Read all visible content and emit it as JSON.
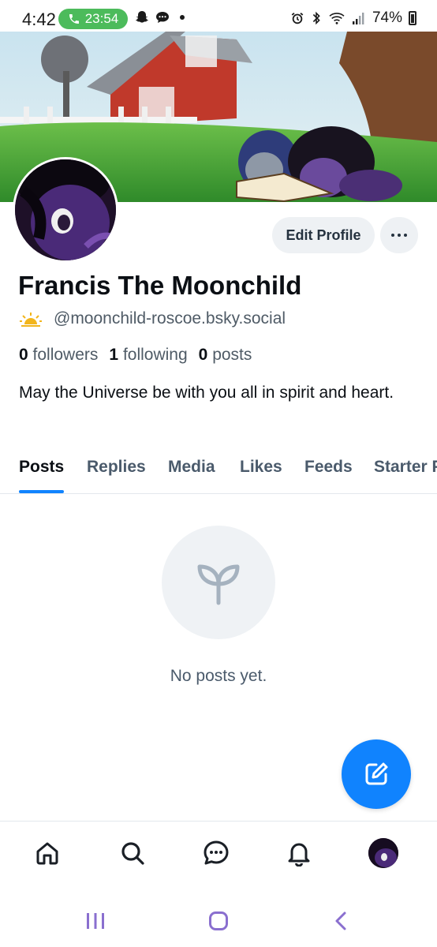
{
  "status_bar": {
    "time": "4:42",
    "call_timer": "23:54",
    "battery": "74%"
  },
  "profile": {
    "display_name": "Francis The Moonchild",
    "handle": "@moonchild-roscoe.bsky.social",
    "followers_count": "0",
    "followers_label": "followers",
    "following_count": "1",
    "following_label": "following",
    "posts_count": "0",
    "posts_label": "posts",
    "bio": "May the Universe be with you all in spirit and heart.",
    "edit_button_label": "Edit Profile"
  },
  "tabs": [
    {
      "label": "Posts",
      "active": true
    },
    {
      "label": "Replies"
    },
    {
      "label": "Media"
    },
    {
      "label": "Likes"
    },
    {
      "label": "Feeds"
    },
    {
      "label": "Starter Packs"
    }
  ],
  "empty_state": {
    "text": "No posts yet.",
    "icon": "sprout-icon"
  },
  "bottom_nav": {
    "items": [
      "home-icon",
      "search-icon",
      "chat-icon",
      "notifications-icon",
      "profile-avatar"
    ]
  },
  "colors": {
    "accent": "#1083fe",
    "call_pill": "#4cbb5b",
    "muted_text": "#4f5b66",
    "chip_bg": "#eef1f4"
  }
}
